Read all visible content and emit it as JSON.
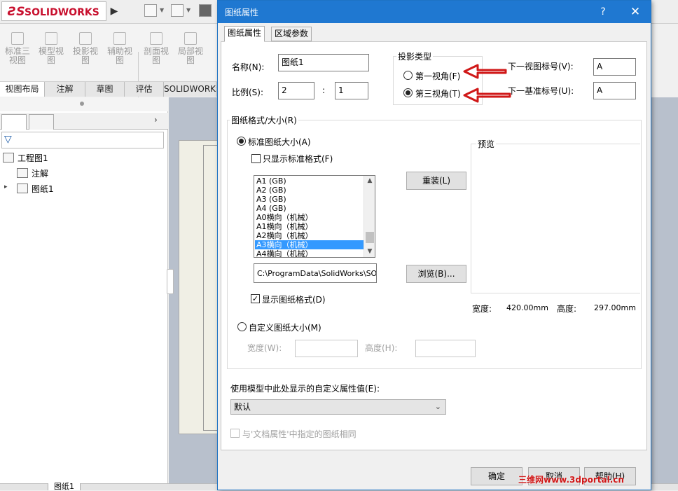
{
  "app": {
    "logo": "SOLIDWORKS",
    "command_items": [
      "标准三视图",
      "模型视图",
      "投影视图",
      "辅助视图",
      "剖面视图",
      "局部视图"
    ],
    "tabs": [
      "视图布局",
      "注解",
      "草图",
      "评估",
      "SOLIDWORKS"
    ],
    "tree": {
      "root": "工程图1",
      "items": [
        "注解",
        "图纸1"
      ]
    },
    "status_tab": "图纸1"
  },
  "dialog": {
    "title": "图纸属性",
    "help": "?",
    "close": "✕",
    "tabs": [
      "图纸属性",
      "区域参数"
    ],
    "name_label": "名称(N):",
    "name_value": "图纸1",
    "scale_label": "比例(S):",
    "scale_num": "2",
    "scale_sep": ":",
    "scale_den": "1",
    "projection": {
      "title": "投影类型",
      "first_angle": "第一视角(F)",
      "third_angle": "第三视角(T)",
      "selected": "third_angle"
    },
    "next_view_label": "下一视图标号(V):",
    "next_view_value": "A",
    "next_datum_label": "下一基准标号(U):",
    "next_datum_value": "A",
    "format_group": {
      "title": "图纸格式/大小(R)",
      "standard_size": "标准图纸大小(A)",
      "only_standard": "只显示标准格式(F)",
      "sizes": [
        "A1 (GB)",
        "A2 (GB)",
        "A3 (GB)",
        "A4 (GB)",
        "A0横向（机械）",
        "A1横向（机械）",
        "A2横向（机械）",
        "A3横向（机械）",
        "A4横向（机械）"
      ],
      "selected_size": "A3横向（机械）",
      "reload": "重装(L)",
      "path": "C:\\ProgramData\\SolidWorks\\SOL",
      "browse": "浏览(B)...",
      "show_format": "显示图纸格式(D)",
      "custom_size": "自定义图纸大小(M)",
      "width_label": "宽度(W):",
      "height_label": "高度(H):",
      "preview": "预览",
      "preview_width_label": "宽度:",
      "preview_width": "420.00mm",
      "preview_height_label": "高度:",
      "preview_height": "297.00mm"
    },
    "custom_prop_label": "使用模型中此处显示的自定义属性值(E):",
    "custom_prop_value": "默认",
    "same_as_doc": "与'文档属性'中指定的图纸相同",
    "ok": "确定",
    "cancel": "取消",
    "help_btn": "帮助(H)"
  },
  "watermark": "三维网www.3dportal.cn",
  "colors": {
    "titlebar": "#1f78d1",
    "selection": "#3399ff",
    "annotation_arrow": "#d01818"
  }
}
